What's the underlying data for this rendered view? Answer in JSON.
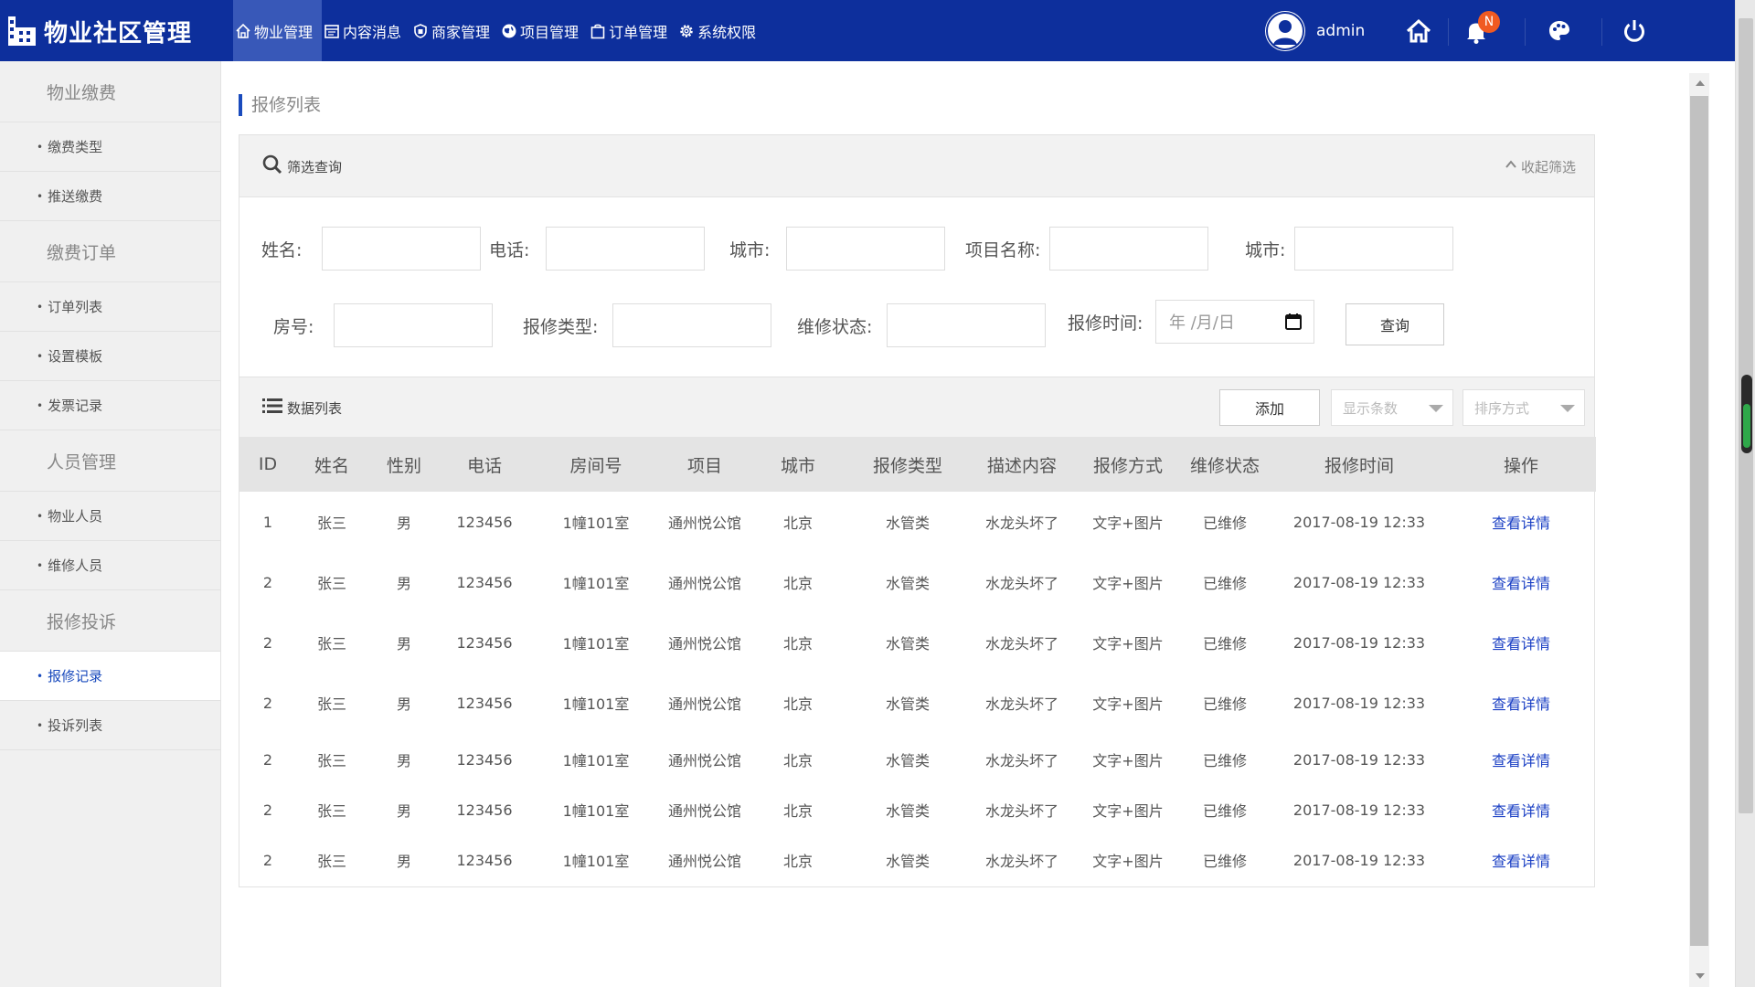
{
  "app": {
    "title": "物业社区管理"
  },
  "nav": [
    {
      "label": "物业管理",
      "icon": "home-outline-icon",
      "active": true
    },
    {
      "label": "内容消息",
      "icon": "calendar-icon",
      "active": false
    },
    {
      "label": "商家管理",
      "icon": "shield-icon",
      "active": false
    },
    {
      "label": "项目管理",
      "icon": "globe-icon",
      "active": false
    },
    {
      "label": "订单管理",
      "icon": "shopping-bag-icon",
      "active": false
    },
    {
      "label": "系统权限",
      "icon": "gear-icon",
      "active": false
    }
  ],
  "user": {
    "name": "admin",
    "notification_badge": "N"
  },
  "sidebar": {
    "groups": [
      {
        "title": "物业缴费",
        "items": [
          {
            "label": "缴费类型"
          },
          {
            "label": "推送缴费"
          }
        ]
      },
      {
        "title": "缴费订单",
        "items": [
          {
            "label": "订单列表"
          },
          {
            "label": "设置模板"
          },
          {
            "label": "发票记录"
          }
        ]
      },
      {
        "title": "人员管理",
        "items": [
          {
            "label": "物业人员"
          },
          {
            "label": "维修人员"
          }
        ]
      },
      {
        "title": "报修投诉",
        "items": [
          {
            "label": "报修记录",
            "active": true
          },
          {
            "label": "投诉列表"
          }
        ]
      }
    ]
  },
  "page": {
    "title": "报修列表"
  },
  "filter": {
    "header": "筛选查询",
    "collapse_label": "收起筛选",
    "fields": {
      "name": "姓名:",
      "phone": "电话:",
      "city1": "城市:",
      "project": "项目名称:",
      "city2": "城市:",
      "room": "房号:",
      "repair_type": "报修类型:",
      "repair_status": "维修状态:",
      "repair_time": "报修时间:"
    },
    "date_placeholder": "年 /月/日",
    "query_button": "查询"
  },
  "data_list": {
    "header": "数据列表",
    "add_button": "添加",
    "page_size_select": "显示条数",
    "sort_select": "排序方式",
    "columns": [
      "ID",
      "姓名",
      "性别",
      "电话",
      "房间号",
      "项目",
      "城市",
      "报修类型",
      "描述内容",
      "报修方式",
      "维修状态",
      "报修时间",
      "操作"
    ],
    "rows": [
      [
        "1",
        "张三",
        "男",
        "123456",
        "1幢101室",
        "通州悦公馆",
        "北京",
        "水管类",
        "水龙头坏了",
        "文字+图片",
        "已维修",
        "2017-08-19 12:33",
        "查看详情"
      ],
      [
        "2",
        "张三",
        "男",
        "123456",
        "1幢101室",
        "通州悦公馆",
        "北京",
        "水管类",
        "水龙头坏了",
        "文字+图片",
        "已维修",
        "2017-08-19 12:33",
        "查看详情"
      ],
      [
        "2",
        "张三",
        "男",
        "123456",
        "1幢101室",
        "通州悦公馆",
        "北京",
        "水管类",
        "水龙头坏了",
        "文字+图片",
        "已维修",
        "2017-08-19 12:33",
        "查看详情"
      ],
      [
        "2",
        "张三",
        "男",
        "123456",
        "1幢101室",
        "通州悦公馆",
        "北京",
        "水管类",
        "水龙头坏了",
        "文字+图片",
        "已维修",
        "2017-08-19 12:33",
        "查看详情"
      ],
      [
        "2",
        "张三",
        "男",
        "123456",
        "1幢101室",
        "通州悦公馆",
        "北京",
        "水管类",
        "水龙头坏了",
        "文字+图片",
        "已维修",
        "2017-08-19 12:33",
        "查看详情"
      ],
      [
        "2",
        "张三",
        "男",
        "123456",
        "1幢101室",
        "通州悦公馆",
        "北京",
        "水管类",
        "水龙头坏了",
        "文字+图片",
        "已维修",
        "2017-08-19 12:33",
        "查看详情"
      ],
      [
        "2",
        "张三",
        "男",
        "123456",
        "1幢101室",
        "通州悦公馆",
        "北京",
        "水管类",
        "水龙头坏了",
        "文字+图片",
        "已维修",
        "2017-08-19 12:33",
        "查看详情"
      ]
    ]
  },
  "colors": {
    "topbar": "#0d2f9c",
    "nav_active": "#3858b8",
    "accent": "#1a4bbd",
    "link": "#1a3fc4",
    "badge": "#f05a22"
  }
}
